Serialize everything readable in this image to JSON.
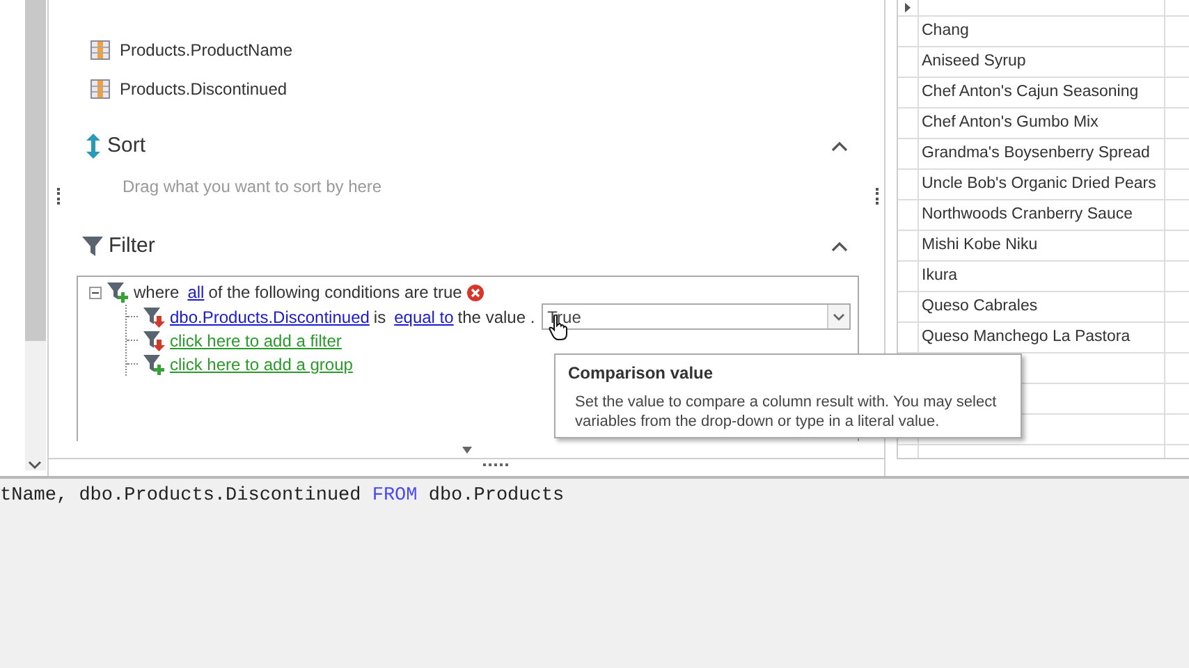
{
  "columns": {
    "items": [
      "Products.ProductName",
      "Products.Discontinued"
    ]
  },
  "sort": {
    "title": "Sort",
    "expanded": true,
    "hint": "Drag what you want to sort by here"
  },
  "filter": {
    "title": "Filter",
    "expanded": true,
    "group": {
      "prefix": "where",
      "quantifier": "all",
      "suffix": "of the following conditions are true",
      "expanded": true
    },
    "condition": {
      "column": "dbo.Products.Discontinued",
      "verb": "is",
      "operator": "equal to",
      "value_label": "the value .",
      "value": "True"
    },
    "links": [
      "click here to add a filter",
      "click here to add a group"
    ]
  },
  "tooltip": {
    "title": "Comparison value",
    "text": "Set the value to compare a column result with. You may select variables from the drop-down or type in a literal value."
  },
  "grid": {
    "rows": [
      "Chang",
      "Aniseed Syrup",
      "Chef Anton's Cajun Seasoning",
      "Chef Anton's Gumbo Mix",
      "Grandma's Boysenberry Spread",
      "Uncle Bob's Organic Dried Pears",
      "Northwoods Cranberry Sauce",
      "Mishi Kobe Niku",
      "Ikura",
      "Queso Cabrales",
      "Queso Manchego La Pastora"
    ]
  },
  "sql": {
    "parts": [
      {
        "kind": "text",
        "text": "tName, dbo.Products.Discontinued "
      },
      {
        "kind": "keyword",
        "text": "FROM"
      },
      {
        "kind": "text",
        "text": " dbo.Products"
      }
    ]
  }
}
